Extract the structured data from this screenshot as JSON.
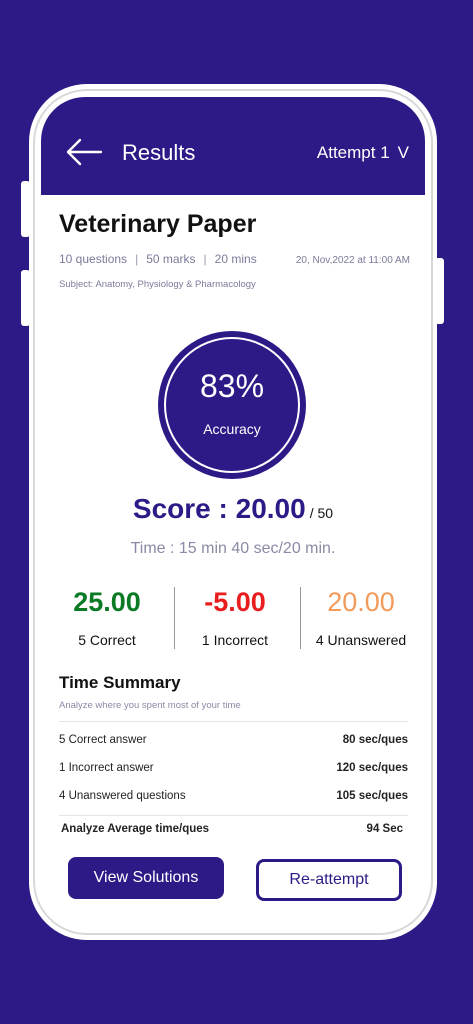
{
  "header": {
    "title": "Results",
    "attempt_label": "Attempt 1",
    "attempt_chevron": "V"
  },
  "paper": {
    "title": "Veterinary Paper",
    "questions": "10 questions",
    "marks": "50 marks",
    "duration": "20 mins",
    "date": "20, Nov,2022 at 11:00 AM",
    "subject": "Subject: Anatomy, Physiology & Pharmacology"
  },
  "accuracy": {
    "percent": "83%",
    "label": "Accuracy"
  },
  "score": {
    "label": "Score : 20.00",
    "total": "/ 50"
  },
  "time": "Time : 15 min  40 sec/20 min.",
  "stats": {
    "correct": {
      "value": "25.00",
      "label": "5 Correct"
    },
    "incorrect": {
      "value": "-5.00",
      "label": "1 Incorrect"
    },
    "unanswered": {
      "value": "20.00",
      "label": "4 Unanswered"
    }
  },
  "time_summary": {
    "title": "Time Summary",
    "subtitle": "Analyze where you spent most of your time",
    "rows": [
      {
        "label": "5 Correct answer",
        "value": "80 sec/ques"
      },
      {
        "label": "1 Incorrect answer",
        "value": "120 sec/ques"
      },
      {
        "label": "4 Unanswered questions",
        "value": "105 sec/ques"
      }
    ],
    "average": {
      "label": "Analyze Average time/ques",
      "value": "94 Sec"
    }
  },
  "actions": {
    "view_solutions": "View Solutions",
    "reattempt": "Re-attempt"
  },
  "colors": {
    "brand": "#2e1a87",
    "correct": "#0b7a25",
    "incorrect": "#e81d1d",
    "unanswered": "#f29a5a"
  },
  "icons": {
    "back": "back-arrow-icon",
    "dropdown": "chevron-down-icon"
  }
}
